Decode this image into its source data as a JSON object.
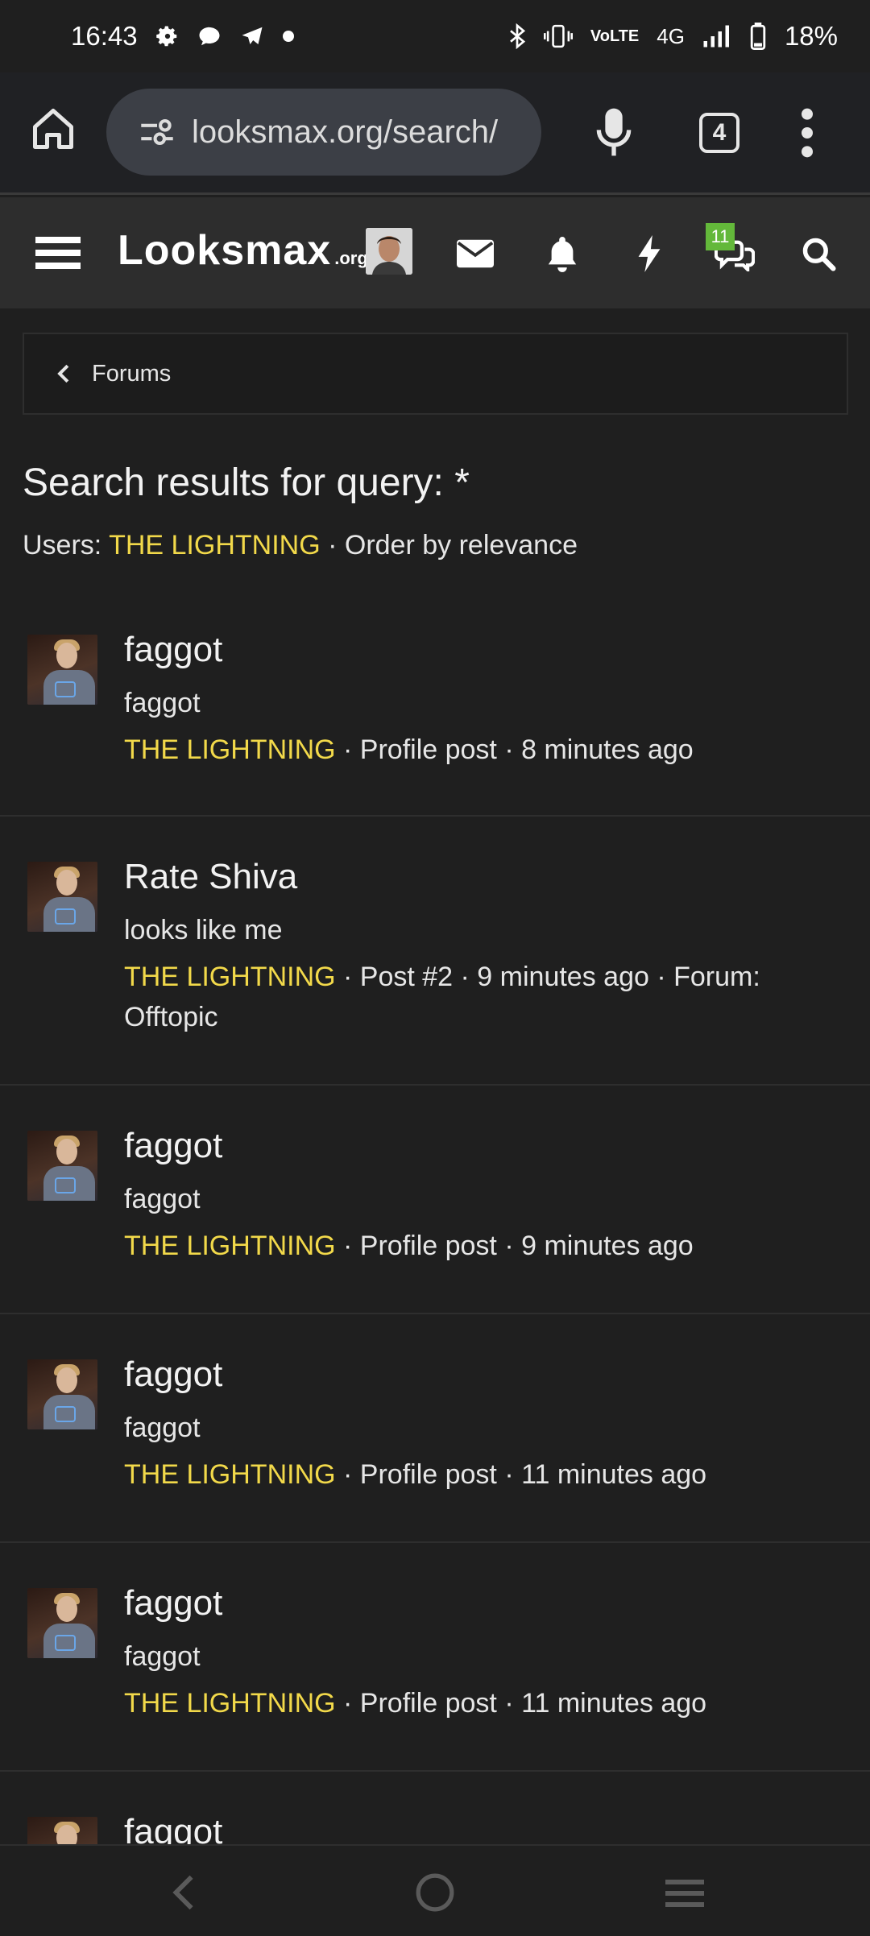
{
  "status_bar": {
    "time": "16:43",
    "network_small": "VoLTE",
    "network": "4G",
    "battery": "18%"
  },
  "browser": {
    "url": "looksmax.org/search/",
    "tab_count": "4"
  },
  "site": {
    "logo_main": "Looksmax",
    "logo_sub": ".org",
    "chat_badge": "11"
  },
  "breadcrumb": {
    "label": "Forums"
  },
  "search": {
    "title": "Search results for query: *",
    "users_prefix": "Users: ",
    "user": "THE LIGHTNING",
    "order": " · Order by relevance"
  },
  "results": [
    {
      "title": "faggot",
      "snippet": "faggot",
      "author": "THE LIGHTNING",
      "meta": " · Profile post · 8 minutes ago"
    },
    {
      "title": "Rate Shiva",
      "snippet": "looks like me",
      "author": "THE LIGHTNING",
      "meta": " · Post #2 · 9 minutes ago · Forum: Offtopic"
    },
    {
      "title": "faggot",
      "snippet": "faggot",
      "author": "THE LIGHTNING",
      "meta": " · Profile post · 9 minutes ago"
    },
    {
      "title": "faggot",
      "snippet": "faggot",
      "author": "THE LIGHTNING",
      "meta": " · Profile post · 11 minutes ago"
    },
    {
      "title": "faggot",
      "snippet": "faggot",
      "author": "THE LIGHTNING",
      "meta": " · Profile post · 11 minutes ago"
    },
    {
      "title": "faggot"
    }
  ],
  "colors": {
    "background": "#1f1f1f",
    "header": "#2d2d2d",
    "accent_yellow": "#f2d94a",
    "badge_green": "#63b83a"
  },
  "icons": {
    "statusbar": [
      "gear-icon",
      "chat-bubble-icon",
      "telegram-icon",
      "dot-icon",
      "bluetooth-icon",
      "vibrate-icon",
      "signal-icon",
      "battery-icon"
    ],
    "browser": [
      "home-icon",
      "site-settings-icon",
      "mic-icon",
      "tabs-icon",
      "more-vert-icon"
    ],
    "header": [
      "hamburger-icon",
      "envelope-icon",
      "bell-icon",
      "lightning-icon",
      "chat-icon",
      "search-icon"
    ],
    "nav": [
      "back-icon",
      "home-circle-icon",
      "recents-icon"
    ]
  }
}
